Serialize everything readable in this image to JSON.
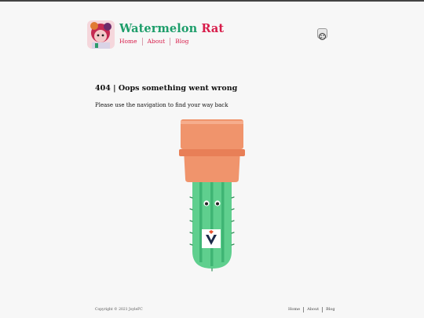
{
  "header": {
    "title_part1": "Watermelon",
    "title_part2": "Rat",
    "nav": [
      {
        "label": "Home"
      },
      {
        "label": "About"
      },
      {
        "label": "Blog"
      }
    ],
    "logo_icon": "watermelon-rat-avatar-icon",
    "theme_toggle_icon": "palette-icon"
  },
  "main": {
    "heading": "404 | Oops something went wrong",
    "message": "Please use the navigation to find your way back",
    "illustration_icon": "cactus-in-upside-down-pot-icon"
  },
  "footer": {
    "copyright": "Copyright © 2021 JoyleFC",
    "nav": [
      {
        "label": "Home"
      },
      {
        "label": "About"
      },
      {
        "label": "Blog"
      }
    ]
  },
  "colors": {
    "accent_green": "#1e9e6b",
    "accent_red": "#d81c4a",
    "pot": "#f0946c",
    "cactus": "#5fcf8e"
  }
}
